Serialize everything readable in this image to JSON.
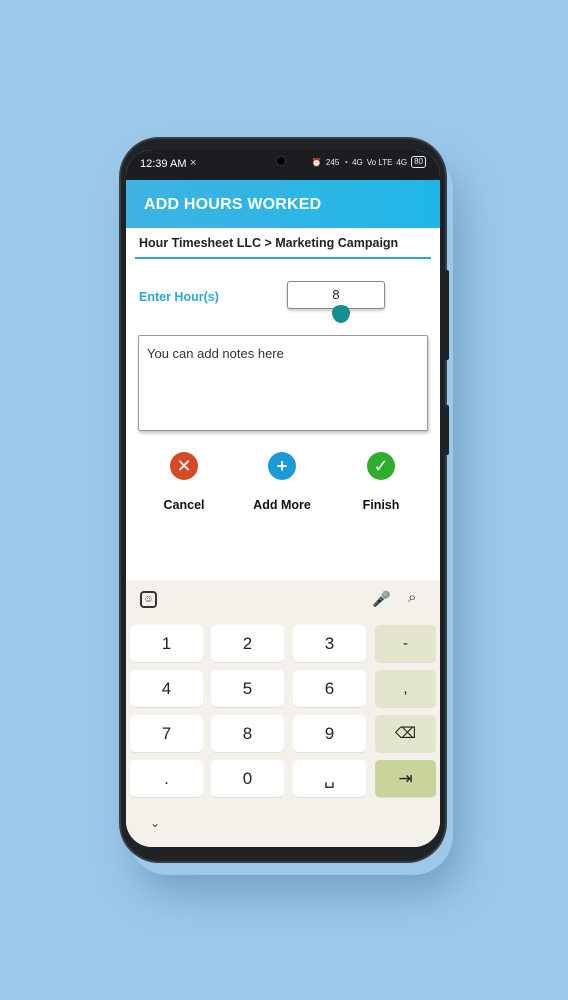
{
  "status_bar": {
    "time": "12:39 AM",
    "x_mark": "×",
    "net_speed": "245",
    "signal1": "4G",
    "signal2": "Vo LTE",
    "signal3": "4G",
    "battery": "80"
  },
  "app_bar": {
    "title": "ADD HOURS WORKED"
  },
  "breadcrumb": "Hour Timesheet LLC > Marketing Campaign",
  "hours": {
    "label": "Enter Hour(s)",
    "value": "8"
  },
  "notes": {
    "placeholder": "You can add notes here"
  },
  "actions": [
    {
      "label": "Cancel",
      "icon": "cancel-icon",
      "color": "#d24a26",
      "glyph": "✕"
    },
    {
      "label": "Add More",
      "icon": "plus-icon",
      "color": "#1a9ad8",
      "glyph": "+"
    },
    {
      "label": "Finish",
      "icon": "check-icon",
      "color": "#2eae2e",
      "glyph": "✓"
    }
  ],
  "keyboard": {
    "keys": [
      [
        "1",
        "2",
        "3",
        "-"
      ],
      [
        "4",
        "5",
        "6",
        ","
      ],
      [
        "7",
        "8",
        "9",
        "⌫"
      ],
      [
        ".",
        "0",
        "␣",
        "⇥"
      ]
    ],
    "emoji": "☺",
    "mic": "🎤",
    "search": "⌕",
    "collapse": "⌄"
  }
}
